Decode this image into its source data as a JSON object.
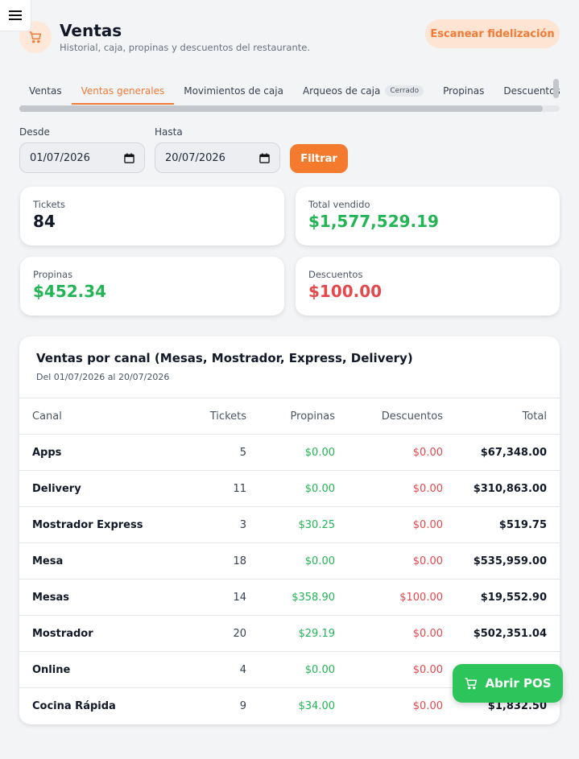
{
  "header": {
    "title": "Ventas",
    "subtitle": "Historial, caja, propinas y descuentos del restaurante.",
    "scan_button": "Escanear fidelización"
  },
  "tabs": [
    {
      "label": "Ventas",
      "active": false
    },
    {
      "label": "Ventas generales",
      "active": true
    },
    {
      "label": "Movimientos de caja",
      "active": false
    },
    {
      "label": "Arqueos de caja",
      "badge": "Cerrado",
      "active": false
    },
    {
      "label": "Propinas",
      "active": false
    },
    {
      "label": "Descuentos",
      "active": false
    }
  ],
  "filters": {
    "from_label": "Desde",
    "from_value": "01/07/2026",
    "to_label": "Hasta",
    "to_value": "20/07/2026",
    "filter_button": "Filtrar"
  },
  "stats": {
    "tickets": {
      "label": "Tickets",
      "value": "84"
    },
    "total": {
      "label": "Total vendido",
      "value": "$1,577,529.19"
    },
    "tips": {
      "label": "Propinas",
      "value": "$452.34"
    },
    "discounts": {
      "label": "Descuentos",
      "value": "$100.00"
    }
  },
  "channel_table": {
    "title": "Ventas por canal (Mesas, Mostrador, Express, Delivery)",
    "range": "Del 01/07/2026 al 20/07/2026",
    "headers": [
      "Canal",
      "Tickets",
      "Propinas",
      "Descuentos",
      "Total"
    ],
    "rows": [
      [
        "Apps",
        "5",
        "$0.00",
        "$0.00",
        "$67,348.00"
      ],
      [
        "Delivery",
        "11",
        "$0.00",
        "$0.00",
        "$310,863.00"
      ],
      [
        "Mostrador Express",
        "3",
        "$30.25",
        "$0.00",
        "$519.75"
      ],
      [
        "Mesa",
        "18",
        "$0.00",
        "$0.00",
        "$535,959.00"
      ],
      [
        "Mesas",
        "14",
        "$358.90",
        "$100.00",
        "$19,552.90"
      ],
      [
        "Mostrador",
        "20",
        "$29.19",
        "$0.00",
        "$502,351.04"
      ],
      [
        "Online",
        "4",
        "$0.00",
        "$0.00",
        ""
      ],
      [
        "Cocina Rápida",
        "9",
        "$34.00",
        "$0.00",
        "$1,832.50"
      ]
    ]
  },
  "pos_button": "Abrir POS",
  "colors": {
    "accent": "#f47b2e",
    "positive": "#22b455",
    "negative": "#e5484d",
    "pos_button": "#2ec45c"
  }
}
